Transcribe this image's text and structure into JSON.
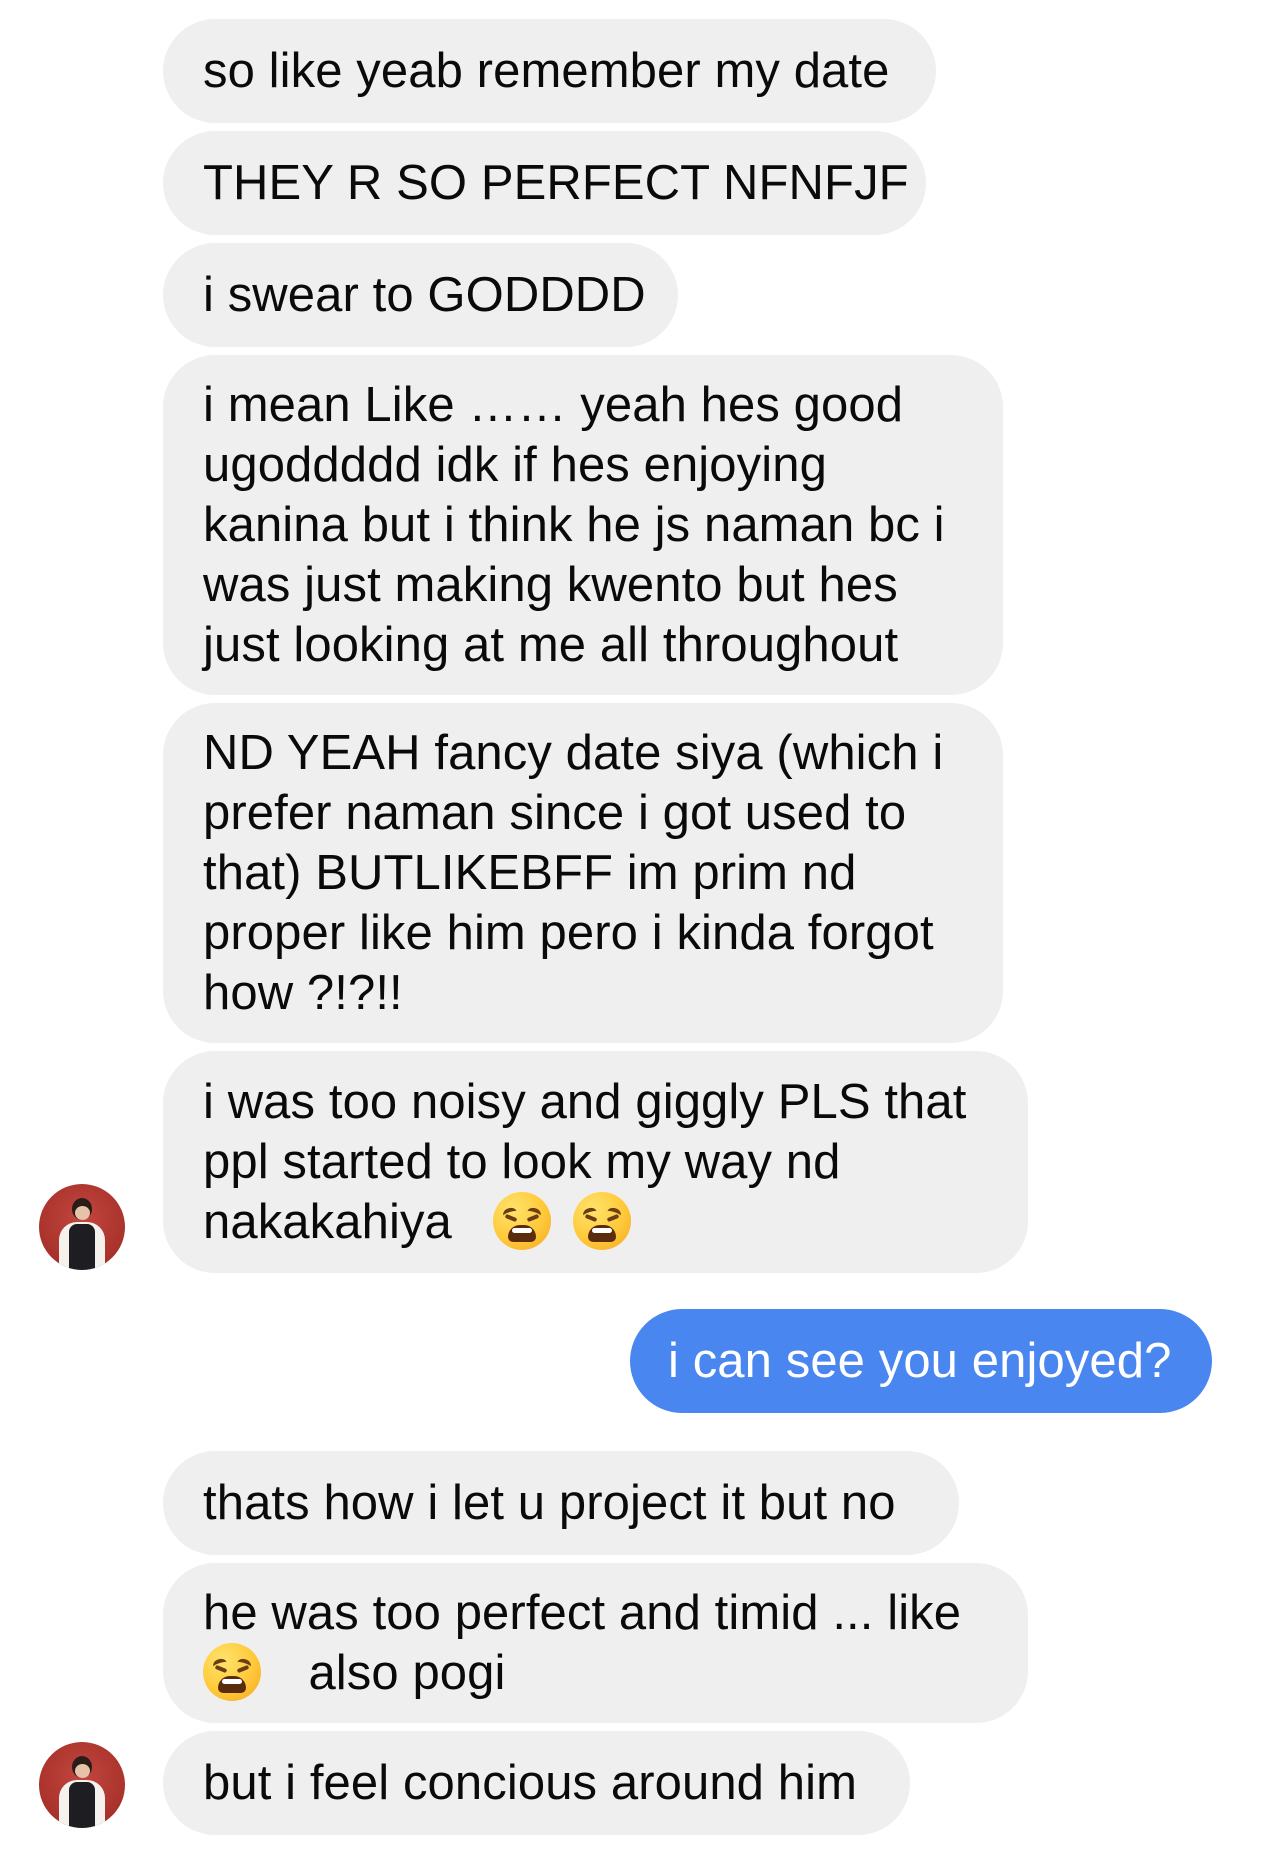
{
  "conversation": {
    "messages": [
      {
        "sender": "them",
        "lines": [
          "so like yeab remember my date"
        ]
      },
      {
        "sender": "them",
        "lines": [
          "THEY R  SO PERFECT NFNFJF"
        ]
      },
      {
        "sender": "them",
        "lines": [
          "i swear to GODDDD"
        ]
      },
      {
        "sender": "them",
        "lines": [
          "i mean Like …… yeah hes good",
          "ugoddddd idk if hes enjoying",
          "kanina but i think he js naman bc i",
          "was just making kwento but hes",
          "just looking at me all throughout"
        ]
      },
      {
        "sender": "them",
        "lines": [
          "ND YEAH fancy date siya (which i",
          "prefer naman since i got used to",
          "that) BUTLIKEBFF im prim nd",
          "proper like him pero i kinda forgot",
          "how ?!?!!"
        ]
      },
      {
        "sender": "them",
        "lines": [
          "i was too noisy and giggly PLS that",
          "ppl started to look my way nd",
          "nakakahiya"
        ],
        "emoji": [
          "weary-face-emoji",
          "weary-face-emoji"
        ]
      },
      {
        "sender": "me",
        "lines": [
          "i can see you enjoyed?"
        ]
      },
      {
        "sender": "them",
        "lines": [
          "thats how i let u project it but no"
        ]
      },
      {
        "sender": "them",
        "lines": [
          "he was too perfect and timid ... like",
          "also pogi"
        ],
        "emoji": [
          "weary-face-emoji"
        ]
      },
      {
        "sender": "them",
        "lines": [
          "but i feel concious around him"
        ]
      }
    ],
    "avatar_icon": "contact-avatar-photo",
    "colors": {
      "incoming_bubble": "#efefef",
      "outgoing_bubble": "#4a86f0",
      "incoming_text": "#0a0a0a",
      "outgoing_text": "#ffffff"
    }
  }
}
